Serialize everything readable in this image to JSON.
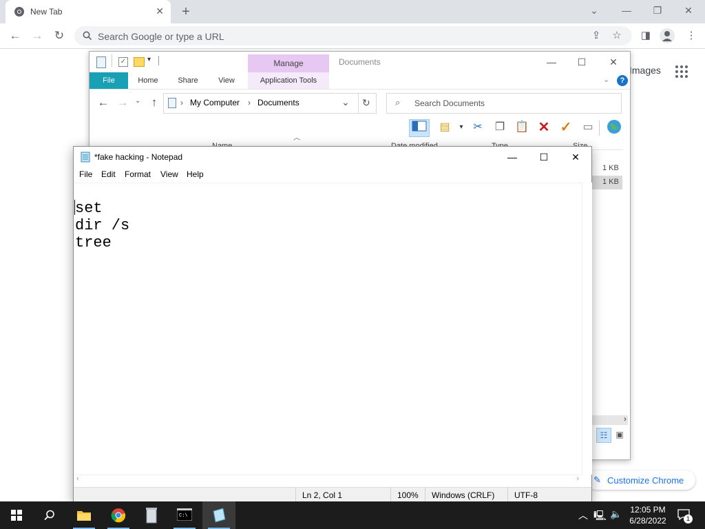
{
  "chrome": {
    "tab_title": "New Tab",
    "new_tab_symbol": "+",
    "omnibox_placeholder": "Search Google or type a URL",
    "images_link": "Images",
    "customize_label": "Customize Chrome",
    "icons": [
      "chrome-logo-icon",
      "close-icon",
      "plus-icon",
      "chevron-down-icon",
      "minimize-icon",
      "restore-icon",
      "back-icon",
      "forward-icon",
      "reload-icon",
      "search-icon",
      "share-icon",
      "star-icon",
      "side-panel-icon",
      "profile-icon",
      "kebab-menu-icon",
      "apps-grid-icon",
      "pencil-icon"
    ]
  },
  "explorer": {
    "manage_label": "Manage",
    "window_title": "Documents",
    "tabs": [
      "File",
      "Home",
      "Share",
      "View",
      "Application Tools"
    ],
    "breadcrumb": [
      "My Computer",
      "Documents"
    ],
    "search_placeholder": "Search Documents",
    "columns": [
      "Name",
      "Date modified",
      "Type",
      "Size"
    ],
    "file_sizes": [
      "1 KB",
      "1 KB"
    ]
  },
  "notepad": {
    "title": "*fake hacking - Notepad",
    "menu": [
      "File",
      "Edit",
      "Format",
      "View",
      "Help"
    ],
    "text": "set\ndir /s\ntree",
    "status": {
      "position": "Ln 2, Col 1",
      "zoom": "100%",
      "line_ending": "Windows (CRLF)",
      "encoding": "UTF-8"
    }
  },
  "taskbar": {
    "apps": [
      "start-icon",
      "search-icon",
      "file-explorer-icon",
      "chrome-icon",
      "recycle-bin-icon",
      "command-prompt-icon",
      "notepad-icon"
    ],
    "time": "12:05 PM",
    "date": "6/28/2022",
    "notification_count": "1"
  }
}
